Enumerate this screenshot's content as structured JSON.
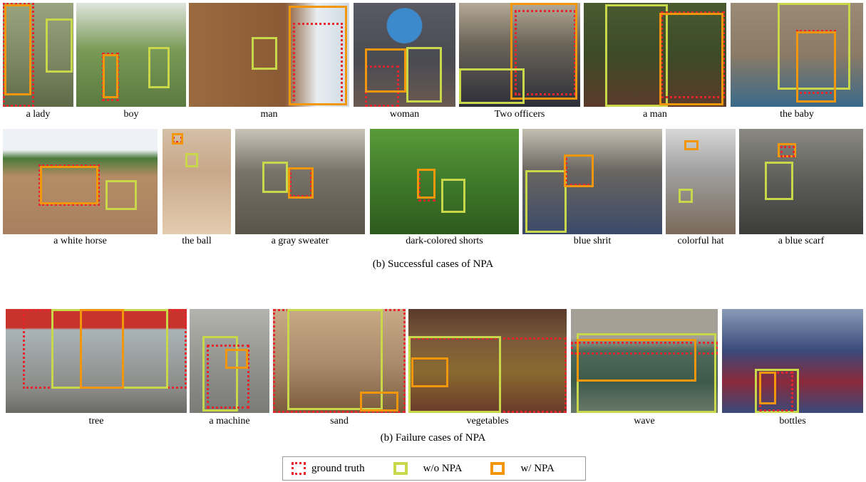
{
  "row1": [
    {
      "caption": "a lady",
      "bg": "#7a8460"
    },
    {
      "caption": "boy",
      "bg": "#6f8c55"
    },
    {
      "caption": "man",
      "bg": "#8a5a35"
    },
    {
      "caption": "woman",
      "bg": "#4a4a52"
    },
    {
      "caption": "Two officers",
      "bg": "#6b6458"
    },
    {
      "caption": "a man",
      "bg": "#3c4a28"
    },
    {
      "caption": "the baby",
      "bg": "#8a7a66"
    }
  ],
  "row2": [
    {
      "caption": "a white horse",
      "bg": "#b48c64"
    },
    {
      "caption": "the ball",
      "bg": "#c8a888"
    },
    {
      "caption": "a gray sweater",
      "bg": "#7a7468"
    },
    {
      "caption": "dark-colored shorts",
      "bg": "#3f7a2a"
    },
    {
      "caption": "blue shrit",
      "bg": "#6a6660"
    },
    {
      "caption": "colorful hat",
      "bg": "#a0a0a0"
    },
    {
      "caption": "a blue scarf",
      "bg": "#5c5c58"
    }
  ],
  "row3": [
    {
      "caption": "tree",
      "bg": "#8a6a5a"
    },
    {
      "caption": "a machine",
      "bg": "#8e8e8a"
    },
    {
      "caption": "sand",
      "bg": "#a88a6a"
    },
    {
      "caption": "vegetables",
      "bg": "#7a5a3a"
    },
    {
      "caption": "wave",
      "bg": "#4f6a5a"
    },
    {
      "caption": "bottles",
      "bg": "#3a4a7a"
    }
  ],
  "subcaption_success": "(b) Successful cases of NPA",
  "subcaption_failure": "(b) Failure cases of NPA",
  "legend": {
    "ground_truth": "ground truth",
    "wo_npa": "w/o NPA",
    "w_npa": "w/ NPA"
  },
  "colors": {
    "ground_truth": "#e8242c",
    "wo_npa": "#c9d84a",
    "w_npa": "#f2960c"
  }
}
